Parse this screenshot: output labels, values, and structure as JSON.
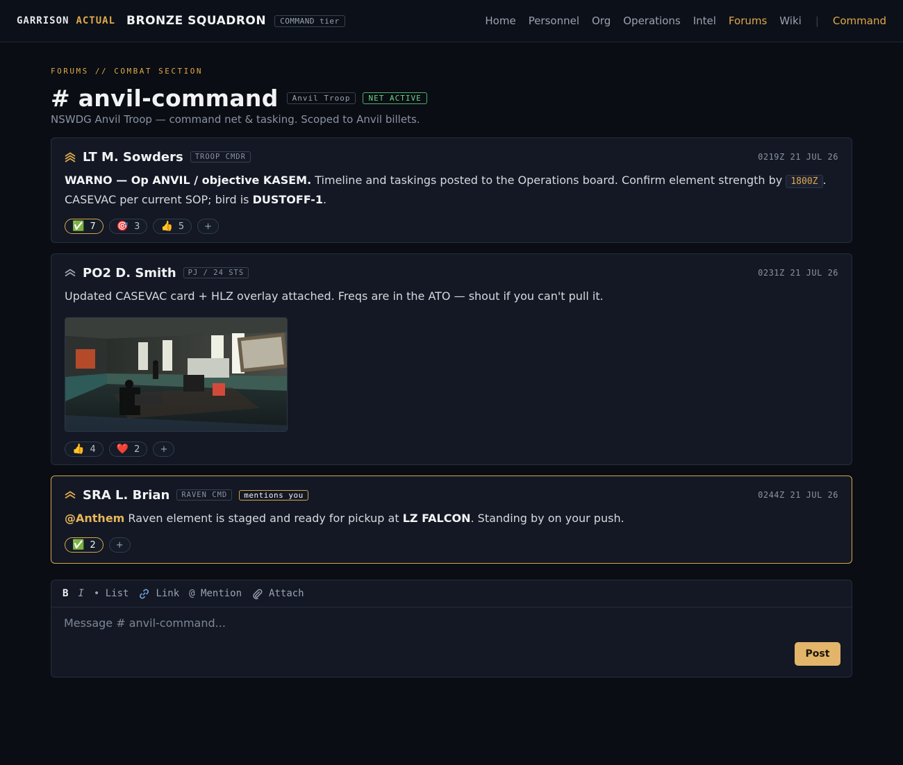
{
  "header": {
    "brand_primary": "GARRISON",
    "brand_accent": "ACTUAL",
    "unit_name": "BRONZE SQUADRON",
    "tier_badge": "COMMAND tier",
    "nav": [
      "Home",
      "Personnel",
      "Org",
      "Operations",
      "Intel",
      "Forums",
      "Wiki"
    ],
    "nav_active": "Forums",
    "nav_separator": "|",
    "command_link": "Command"
  },
  "channel": {
    "breadcrumb": "FORUMS // COMBAT SECTION",
    "title": "# anvil-command",
    "badge_unit": "Anvil Troop",
    "badge_status": "NET ACTIVE",
    "description": "NSWDG Anvil Troop — command net & tasking. Scoped to Anvil billets."
  },
  "posts": [
    {
      "author": "LT M. Sowders",
      "role": "TROOP CMDR",
      "timestamp": "0219Z 21 JUL 26",
      "rank_icon": "chevron-triple-icon",
      "body": {
        "bold_lead": "WARNO — Op ANVIL / objective KASEM.",
        "text_1": " Timeline and taskings posted to the Operations board. Confirm element strength by ",
        "code": "1800Z",
        "text_2": ". CASEVAC per current SOP; bird is ",
        "bold_tail": "DUSTOFF-1",
        "text_3": "."
      },
      "reactions": [
        {
          "emoji": "✅",
          "count": "7",
          "mine": true
        },
        {
          "emoji": "🎯",
          "count": "3",
          "mine": false
        },
        {
          "emoji": "👍",
          "count": "5",
          "mine": false
        }
      ],
      "add_reaction": "+"
    },
    {
      "author": "PO2 D. Smith",
      "role": "PJ / 24 STS",
      "timestamp": "0231Z 21 JUL 26",
      "rank_icon": "chevron-double-icon",
      "body": {
        "text": "Updated CASEVAC card + HLZ overlay attached. Freqs are in the ATO — shout if you can't pull it."
      },
      "attachment_icon": "image-attachment-icon",
      "reactions": [
        {
          "emoji": "👍",
          "count": "4",
          "mine": false
        },
        {
          "emoji": "❤️",
          "count": "2",
          "mine": false
        }
      ],
      "add_reaction": "+"
    },
    {
      "author": "SRA L. Brian",
      "role": "RAVEN CMD",
      "mention_badge": "mentions you",
      "timestamp": "0244Z 21 JUL 26",
      "rank_icon": "chevron-double-icon",
      "body": {
        "mention": "@Anthem",
        "text_1": " Raven element is staged and ready for pickup at ",
        "bold": "LZ FALCON",
        "text_2": ". Standing by on your push."
      },
      "reactions": [
        {
          "emoji": "✅",
          "count": "2",
          "mine": true
        }
      ],
      "add_reaction": "+"
    }
  ],
  "composer": {
    "bold": "B",
    "italic": "I",
    "list": "• List",
    "link": "Link",
    "mention": "@ Mention",
    "attach": "Attach",
    "placeholder": "Message # anvil-command...",
    "post_label": "Post"
  },
  "colors": {
    "accent": "#e0a94a",
    "background": "#0a0d13",
    "card": "#131824",
    "status_green": "#6fd08a"
  }
}
